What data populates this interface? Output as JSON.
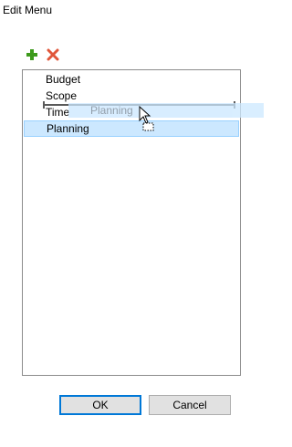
{
  "window": {
    "title": "Edit Menu"
  },
  "toolbar": {
    "add_icon": "plus-icon",
    "remove_icon": "x-icon",
    "add_color": "#3d9a1c",
    "remove_color": "#e0563a"
  },
  "list": {
    "items": [
      "Budget",
      "Scope",
      "Time",
      "Planning"
    ],
    "selected": "Planning"
  },
  "drag": {
    "ghost_label": "Planning"
  },
  "buttons": {
    "ok": "OK",
    "cancel": "Cancel"
  },
  "colors": {
    "selection": "#cce8ff",
    "focus": "#0078d7"
  }
}
